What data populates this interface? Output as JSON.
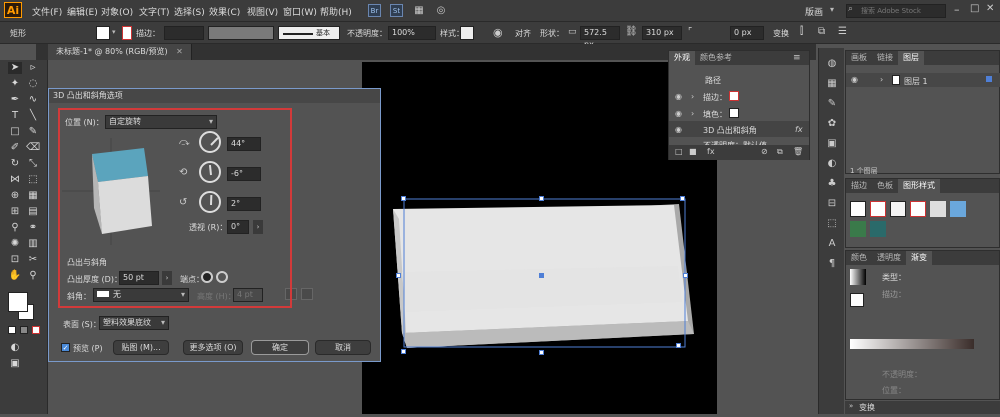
{
  "app": {
    "logo": "Ai",
    "menus": [
      "文件(F)",
      "编辑(E)",
      "对象(O)",
      "文字(T)",
      "选择(S)",
      "效果(C)",
      "视图(V)",
      "窗口(W)",
      "帮助(H)"
    ],
    "app_icons": [
      "Br",
      "St"
    ],
    "workspace": "版画",
    "stock_search_placeholder": "搜索 Adobe Stock"
  },
  "control_bar": {
    "shape_label": "矩形",
    "stroke_label": "描边：",
    "stroke_style": "基本",
    "opacity_label": "不透明度：",
    "opacity_value": "100%",
    "style_label": "样式：",
    "align_label": "对齐",
    "shape_label2": "形状：",
    "width_value": "572.5 px",
    "height_value": "310 px",
    "corner_value": "0 px",
    "transform_label": "变换"
  },
  "document": {
    "tab_title": "未标题-1* @ 80% (RGB/预览)"
  },
  "dialog": {
    "title": "3D 凸出和斜角选项",
    "position_label": "位置 (N)：",
    "position_value": "自定旋转",
    "rot_x": "44°",
    "rot_y": "-6°",
    "rot_z": "2°",
    "perspective_label": "透视 (R)：",
    "perspective_value": "0°",
    "extrude_section": "凸出与斜角",
    "extrude_depth_label": "凸出厚度 (D)：",
    "extrude_depth_value": "50 pt",
    "cap_label": "端点：",
    "bevel_label": "斜角：",
    "bevel_value": "无",
    "height_label": "高度 (H)：",
    "height_value": "4 pt",
    "surface_label": "表面 (S)：",
    "surface_value": "塑料效果底纹",
    "preview_label": "预览 (P)",
    "map_button": "贴图 (M)...",
    "more_options_button": "更多选项 (O)",
    "ok_button": "确定",
    "cancel_button": "取消"
  },
  "appearance_panel": {
    "tabs": [
      "外观",
      "颜色参考"
    ],
    "path_label": "路径",
    "stroke_row": "描边：",
    "fill_row": "填色：",
    "effect_row": "3D 凸出和斜角",
    "opacity_row": "不透明度：默认值",
    "fx": "fx"
  },
  "layers_panel": {
    "tabs": [
      "画板",
      "链接",
      "图层"
    ],
    "layer_name": "图层 1",
    "footer": "1 个图层"
  },
  "styles_panel": {
    "tabs": [
      "描边",
      "色板",
      "图形样式"
    ]
  },
  "gradient_panel": {
    "tabs": [
      "颜色",
      "透明度",
      "渐变"
    ],
    "type_label": "类型：",
    "stroke_label": "描边：",
    "opacity_label": "不透明度：",
    "location_label": "位置："
  },
  "transform_panel": {
    "title": "变换"
  },
  "colors": {
    "cube_top": "#5ba4bd",
    "selection": "#4f7fd6",
    "dialog_border_red": "#d23a3a"
  }
}
